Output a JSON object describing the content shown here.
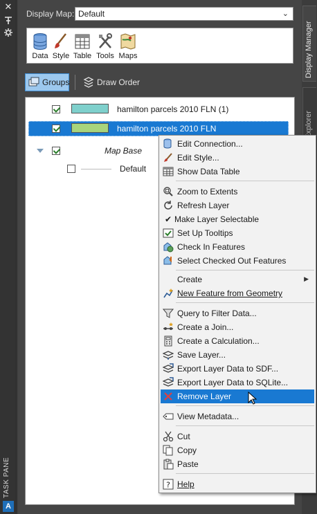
{
  "task_pane": {
    "label": "TASK PANE",
    "logo": "A",
    "icons": [
      "close-icon",
      "pin-icon",
      "settings-icon"
    ]
  },
  "display_map": {
    "label": "Display Map:",
    "value": "Default"
  },
  "toolbar": {
    "items": [
      {
        "label": "Data",
        "icon": "database-icon"
      },
      {
        "label": "Style",
        "icon": "brush-icon"
      },
      {
        "label": "Table",
        "icon": "table-icon"
      },
      {
        "label": "Tools",
        "icon": "tools-icon"
      },
      {
        "label": "Maps",
        "icon": "maps-icon"
      }
    ]
  },
  "view_toggle": {
    "groups": "Groups",
    "draw_order": "Draw Order"
  },
  "layers": [
    {
      "label": "hamilton parcels 2010 FLN (1)",
      "checked": true,
      "color": "#7fd0cc",
      "selected": false
    },
    {
      "label": "hamilton parcels 2010 FLN",
      "checked": true,
      "color": "#a8d47c",
      "selected": true
    },
    {
      "label": "Map Base",
      "checked": true,
      "group": true
    },
    {
      "label": "Default",
      "checked": false
    }
  ],
  "side_tabs": {
    "display_manager": "Display Manager",
    "explorer": "Explorer"
  },
  "context_menu": {
    "items": [
      {
        "id": "edit-connection",
        "label": "Edit Connection..."
      },
      {
        "id": "edit-style",
        "label": "Edit Style..."
      },
      {
        "id": "show-data-table",
        "label": "Show Data Table"
      },
      {
        "id": "zoom-to-extents",
        "label": "Zoom to Extents"
      },
      {
        "id": "refresh-layer",
        "label": "Refresh Layer"
      },
      {
        "id": "make-layer-selectable",
        "label": "Make Layer Selectable",
        "checked": true
      },
      {
        "id": "set-up-tooltips",
        "label": "Set Up Tooltips"
      },
      {
        "id": "check-in-features",
        "label": "Check In Features"
      },
      {
        "id": "select-checked-out-features",
        "label": "Select Checked Out Features"
      },
      {
        "id": "create",
        "label": "Create"
      },
      {
        "id": "new-feature-from-geometry",
        "label": "New Feature from Geometry"
      },
      {
        "id": "query-to-filter-data",
        "label": "Query to Filter Data..."
      },
      {
        "id": "create-a-join",
        "label": "Create a Join..."
      },
      {
        "id": "create-a-calculation",
        "label": "Create a Calculation..."
      },
      {
        "id": "save-layer",
        "label": "Save Layer..."
      },
      {
        "id": "export-layer-data-to-sdf",
        "label": "Export Layer Data to SDF..."
      },
      {
        "id": "export-layer-data-to-sqlite",
        "label": "Export Layer Data to SQLite..."
      },
      {
        "id": "remove-layer",
        "label": "Remove Layer",
        "highlighted": true
      },
      {
        "id": "view-metadata",
        "label": "View Metadata..."
      },
      {
        "id": "cut",
        "label": "Cut"
      },
      {
        "id": "copy",
        "label": "Copy"
      },
      {
        "id": "paste",
        "label": "Paste"
      },
      {
        "id": "help",
        "label": "Help"
      }
    ]
  },
  "colors": {
    "selection": "#1979d2",
    "panel_bg": "#454545",
    "menu_bg": "#f2f2f2"
  }
}
